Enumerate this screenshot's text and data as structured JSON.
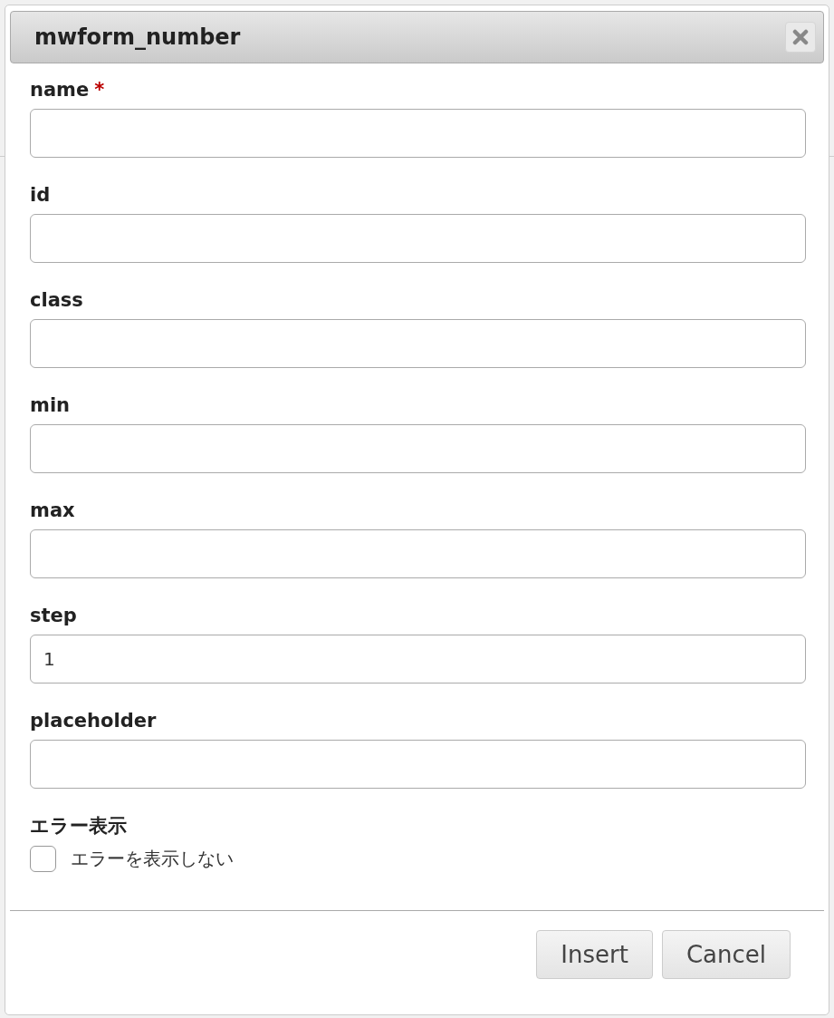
{
  "dialog": {
    "title": "mwform_number"
  },
  "fields": [
    {
      "label": "name",
      "required_mark": "*"
    },
    {
      "label": "id"
    },
    {
      "label": "class"
    },
    {
      "label": "min"
    },
    {
      "label": "max"
    },
    {
      "label": "step",
      "value": "1"
    },
    {
      "label": "placeholder"
    }
  ],
  "error_section": {
    "label": "エラー表示",
    "checkbox": {
      "label": "エラーを表示しない",
      "checked": false
    }
  },
  "buttons": [
    {
      "label": "Insert"
    },
    {
      "label": "Cancel"
    }
  ]
}
